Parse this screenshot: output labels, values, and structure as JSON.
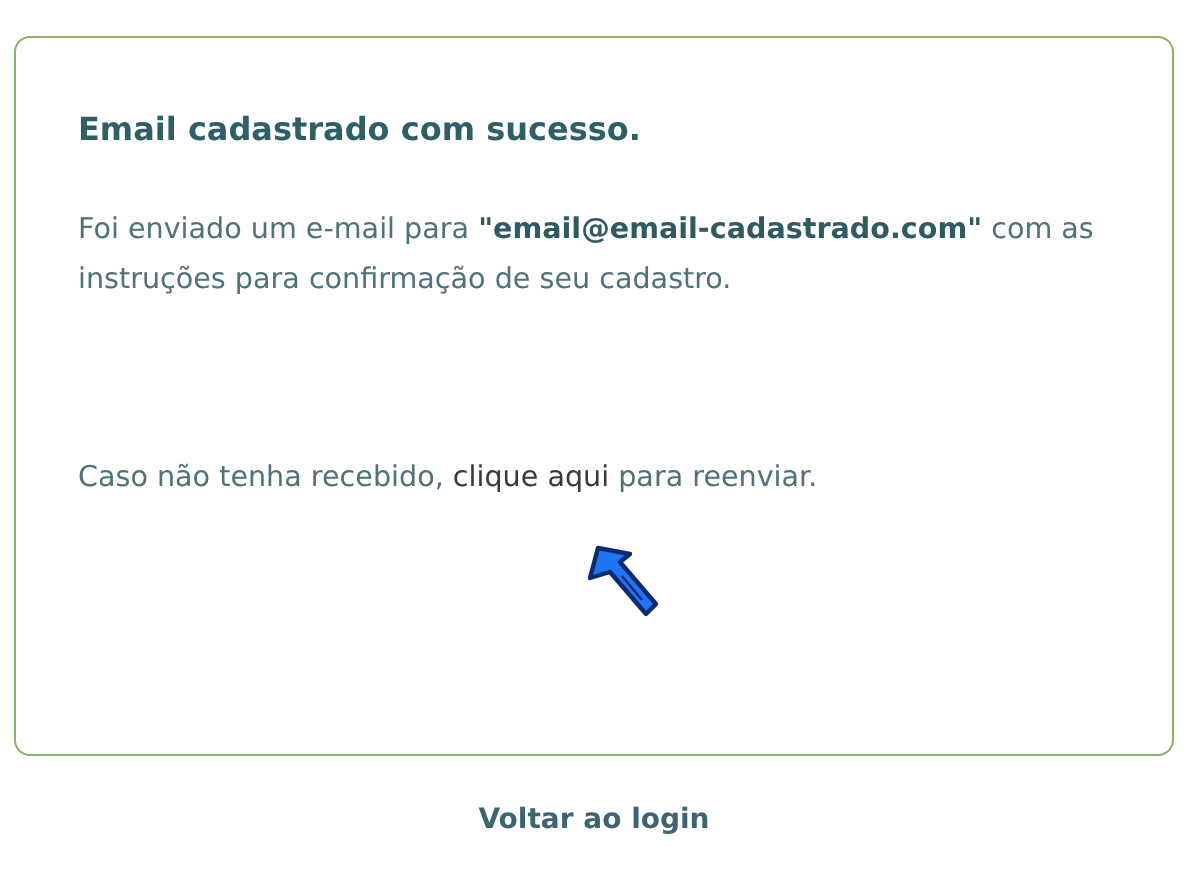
{
  "card": {
    "title": "Email cadastrado com sucesso.",
    "message": "Foi enviado um e-mail para **\"email@email-cadastrado.com\"** com as instruções para confirmação de seu cadastro.",
    "resend": {
      "before": "Caso não tenha recebido, ",
      "link": "clique aqui",
      "after": " para reenviar."
    }
  },
  "back_link": "Voltar ao login"
}
